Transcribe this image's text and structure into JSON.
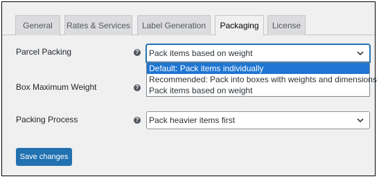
{
  "tabs": [
    {
      "label": "General",
      "active": false
    },
    {
      "label": "Rates & Services",
      "active": false
    },
    {
      "label": "Label Generation",
      "active": false
    },
    {
      "label": "Packaging",
      "active": true
    },
    {
      "label": "License",
      "active": false
    }
  ],
  "fields": {
    "parcel_packing": {
      "label": "Parcel Packing",
      "value": "Pack items based on weight",
      "options": [
        "Default: Pack items individually",
        "Recommended: Pack into boxes with weights and dimensions",
        "Pack items based on weight"
      ],
      "highlighted_option": "Default: Pack items individually"
    },
    "box_max_weight": {
      "label": "Box Maximum Weight"
    },
    "packing_process": {
      "label": "Packing Process",
      "value": "Pack heavier items first"
    }
  },
  "help_icon_glyph": "?",
  "save_button": {
    "label": "Save changes"
  },
  "colors": {
    "accent": "#2271b1",
    "highlight": "#1e75d2",
    "background": "#f0f0f1"
  }
}
